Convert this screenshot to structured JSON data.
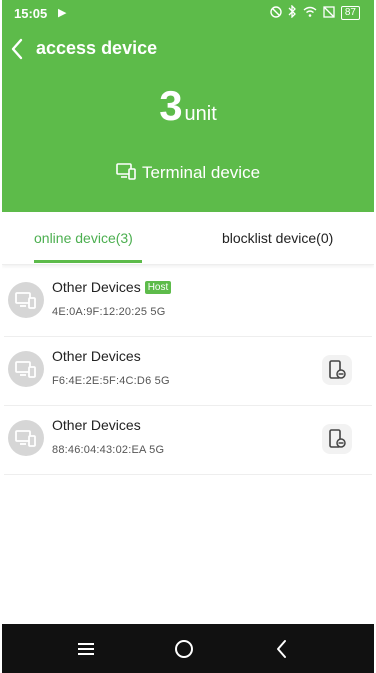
{
  "status_bar": {
    "time": "15:05",
    "battery": "87",
    "icons": [
      "play-icon",
      "nfc-icon",
      "bluetooth-icon",
      "wifi-icon",
      "sim-icon",
      "battery-icon"
    ]
  },
  "header": {
    "title": "access device",
    "count": "3",
    "unit": "unit",
    "terminal_label": "Terminal device"
  },
  "tabs": [
    {
      "label": "online device(3)",
      "active": true
    },
    {
      "label": "blocklist device(0)",
      "active": false
    }
  ],
  "devices": [
    {
      "name": "Other Devices",
      "badge": "Host",
      "mac": "4E:0A:9F:12:20:25 5G"
    },
    {
      "name": "Other Devices",
      "mac": "F6:4E:2E:5F:4C:D6 5G"
    },
    {
      "name": "Other Devices",
      "mac": "88:46:04:43:02:EA 5G"
    }
  ],
  "colors": {
    "accent": "#5dbb4a",
    "active_tab": "#4caf50",
    "nav_bar": "#111111"
  }
}
